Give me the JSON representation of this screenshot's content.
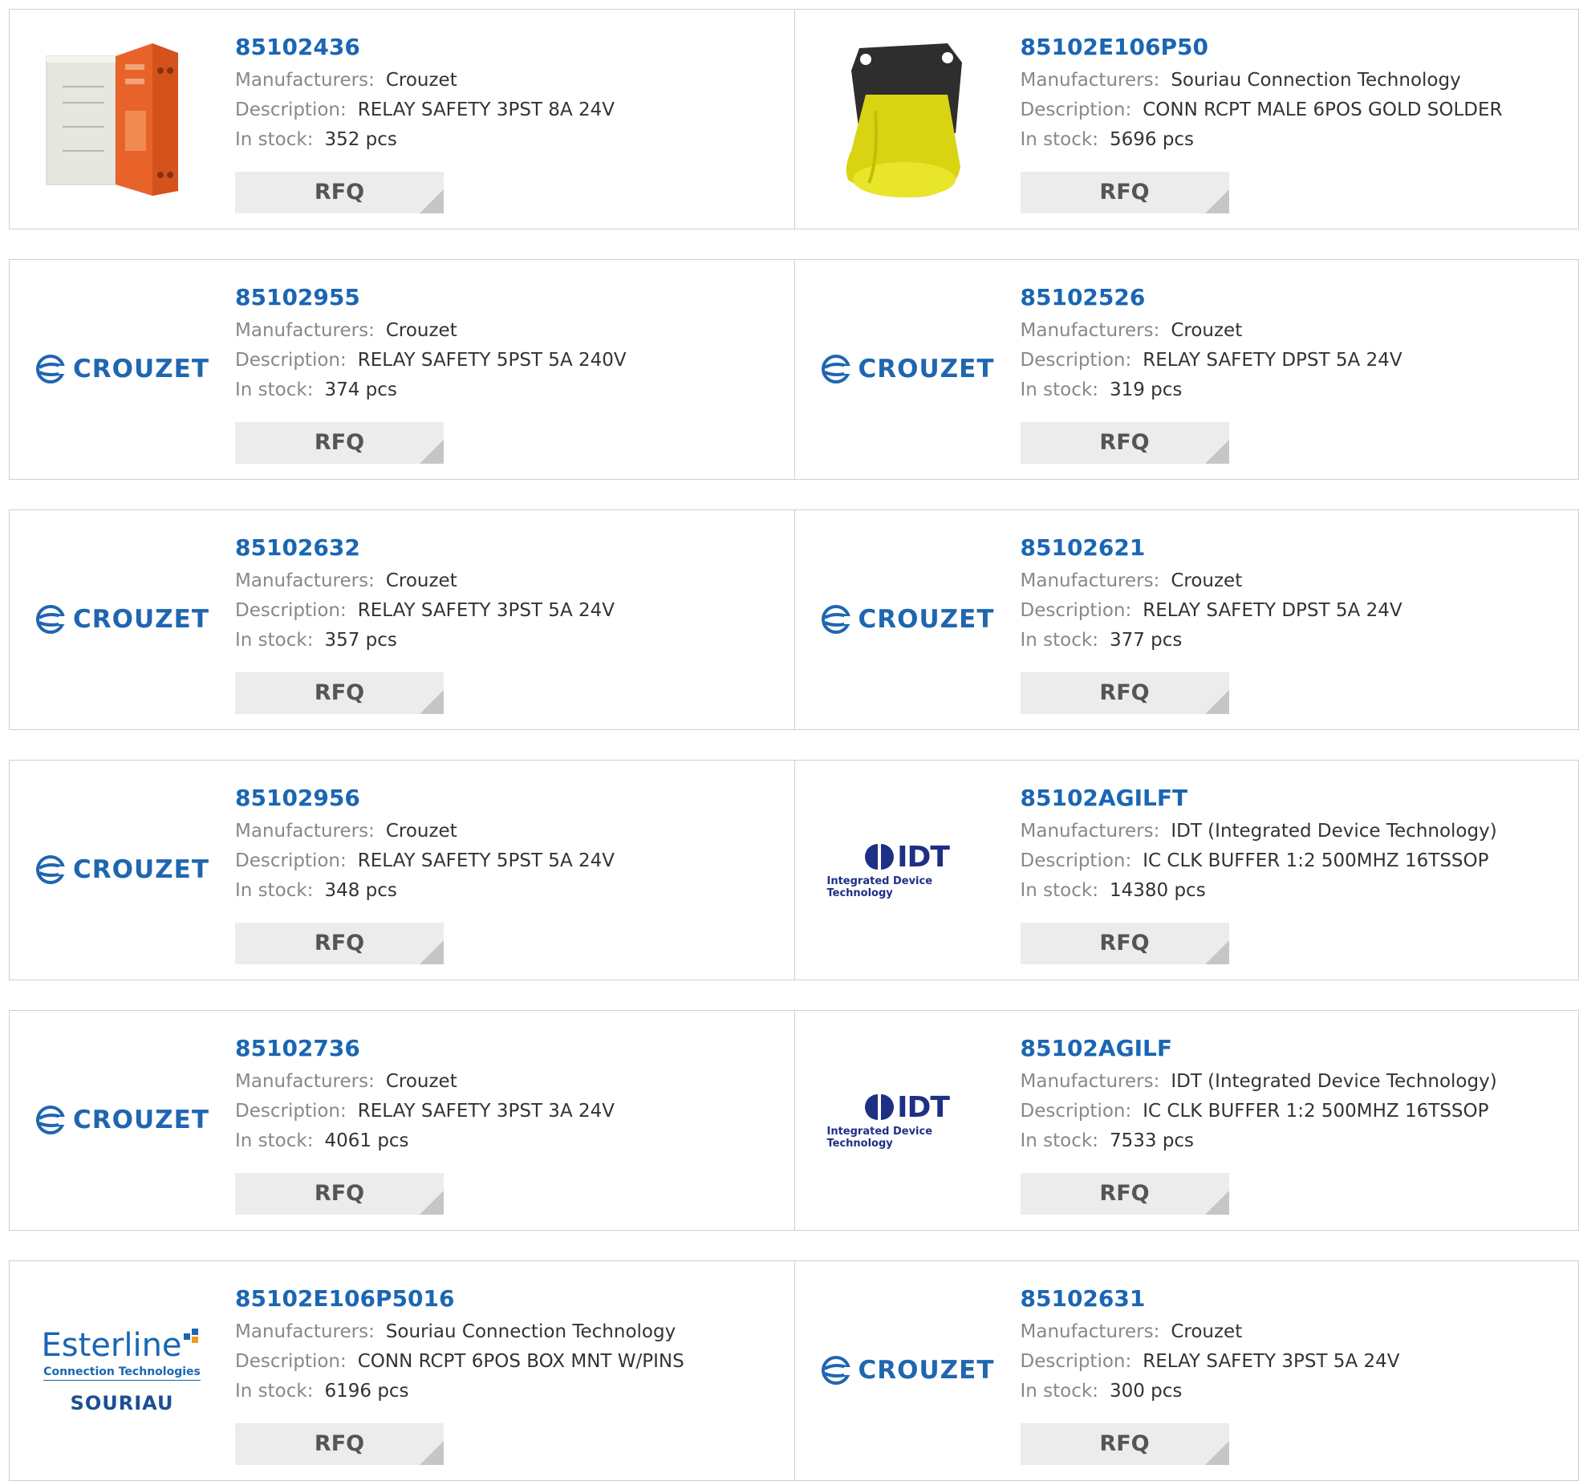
{
  "labels": {
    "manufacturers": "Manufacturers:",
    "description": "Description:",
    "in_stock": "In stock:",
    "rfq": "RFQ"
  },
  "brands": {
    "crouzet": "CROUZET",
    "idt": "IDT",
    "idt_sub": "Integrated Device Technology",
    "esterline": "Esterline",
    "esterline_sub": "Connection Technologies",
    "souriau": "SOURIAU"
  },
  "colors": {
    "link_blue": "#1a66b3",
    "label_gray": "#888888",
    "button_bg": "#ececec"
  },
  "products": [
    {
      "part": "85102436",
      "manufacturer": "Crouzet",
      "description": "RELAY SAFETY 3PST 8A 24V",
      "stock": "352 pcs",
      "image": "relay-photo"
    },
    {
      "part": "85102E106P50",
      "manufacturer": "Souriau Connection Technology",
      "description": "CONN RCPT MALE 6POS GOLD SOLDER",
      "stock": "5696 pcs",
      "image": "connector-photo"
    },
    {
      "part": "85102955",
      "manufacturer": "Crouzet",
      "description": "RELAY SAFETY 5PST 5A 240V",
      "stock": "374 pcs",
      "image": "crouzet-logo"
    },
    {
      "part": "85102526",
      "manufacturer": "Crouzet",
      "description": "RELAY SAFETY DPST 5A 24V",
      "stock": "319 pcs",
      "image": "crouzet-logo"
    },
    {
      "part": "85102632",
      "manufacturer": "Crouzet",
      "description": "RELAY SAFETY 3PST 5A 24V",
      "stock": "357 pcs",
      "image": "crouzet-logo"
    },
    {
      "part": "85102621",
      "manufacturer": "Crouzet",
      "description": "RELAY SAFETY DPST 5A 24V",
      "stock": "377 pcs",
      "image": "crouzet-logo"
    },
    {
      "part": "85102956",
      "manufacturer": "Crouzet",
      "description": "RELAY SAFETY 5PST 5A 24V",
      "stock": "348 pcs",
      "image": "crouzet-logo"
    },
    {
      "part": "85102AGILFT",
      "manufacturer": "IDT (Integrated Device Technology)",
      "description": "IC CLK BUFFER 1:2 500MHZ 16TSSOP",
      "stock": "14380 pcs",
      "image": "idt-logo"
    },
    {
      "part": "85102736",
      "manufacturer": "Crouzet",
      "description": "RELAY SAFETY 3PST 3A 24V",
      "stock": "4061 pcs",
      "image": "crouzet-logo"
    },
    {
      "part": "85102AGILF",
      "manufacturer": "IDT (Integrated Device Technology)",
      "description": "IC CLK BUFFER 1:2 500MHZ 16TSSOP",
      "stock": "7533 pcs",
      "image": "idt-logo"
    },
    {
      "part": "85102E106P5016",
      "manufacturer": "Souriau Connection Technology",
      "description": "CONN RCPT 6POS BOX MNT W/PINS",
      "stock": "6196 pcs",
      "image": "esterline-souriau-logo"
    },
    {
      "part": "85102631",
      "manufacturer": "Crouzet",
      "description": "RELAY SAFETY 3PST 5A 24V",
      "stock": "300 pcs",
      "image": "crouzet-logo"
    }
  ]
}
